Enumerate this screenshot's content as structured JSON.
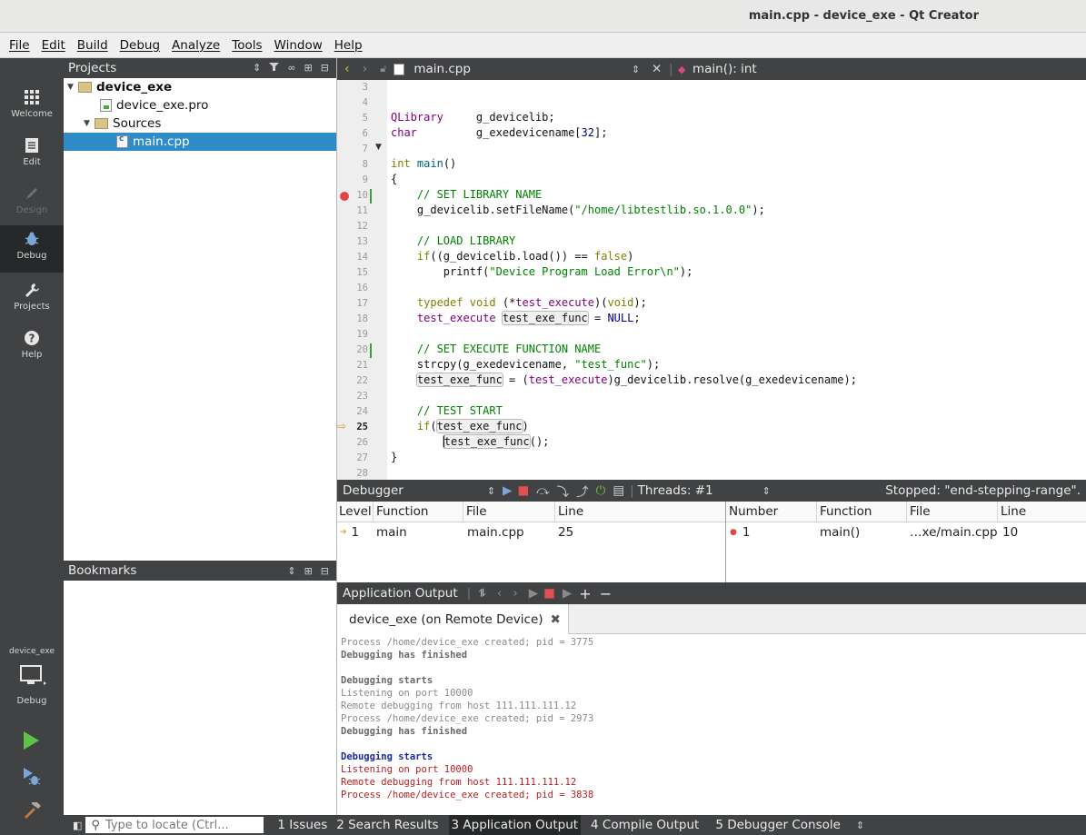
{
  "window": {
    "title": "main.cpp - device_exe - Qt Creator"
  },
  "menu": [
    "File",
    "Edit",
    "Build",
    "Debug",
    "Analyze",
    "Tools",
    "Window",
    "Help"
  ],
  "modes": [
    {
      "label": "Welcome",
      "icon": "grid-icon"
    },
    {
      "label": "Edit",
      "icon": "document-icon"
    },
    {
      "label": "Design",
      "icon": "pencil-icon"
    },
    {
      "label": "Debug",
      "icon": "bug-icon"
    },
    {
      "label": "Projects",
      "icon": "wrench-icon"
    },
    {
      "label": "Help",
      "icon": "question-icon"
    }
  ],
  "kit": {
    "project": "device_exe",
    "config": "Debug"
  },
  "projects_pane": {
    "title": "Projects",
    "tree": [
      {
        "label": "device_exe",
        "indent": 0,
        "bold": true,
        "icon": "folder-icon",
        "expanded": true
      },
      {
        "label": "device_exe.pro",
        "indent": 1,
        "icon": "pro-file-icon"
      },
      {
        "label": "Sources",
        "indent": 1,
        "icon": "folder-icon",
        "expanded": true
      },
      {
        "label": "main.cpp",
        "indent": 2,
        "icon": "cpp-file-icon",
        "selected": true
      }
    ]
  },
  "bookmarks_pane": {
    "title": "Bookmarks"
  },
  "editor": {
    "file": "main.cpp",
    "symbol": "main(): int",
    "first_line": 3,
    "current_line": 25,
    "breakpoint_line": 10
  },
  "debugger": {
    "title": "Debugger",
    "threads": "Threads: #1",
    "status": "Stopped: \"end-stepping-range\".",
    "stack_headers": [
      "Level",
      "Function",
      "File",
      "Line"
    ],
    "stack_rows": [
      {
        "level": "1",
        "function": "main",
        "file": "main.cpp",
        "line": "25"
      }
    ],
    "bp_headers": [
      "Number",
      "Function",
      "File",
      "Line"
    ],
    "bp_rows": [
      {
        "number": "1",
        "function": "main()",
        "file": "…xe/main.cpp",
        "line": "10"
      }
    ]
  },
  "app_output": {
    "title": "Application Output",
    "tab": "device_exe (on Remote Device)",
    "lines": [
      {
        "text": "Process /home/device_exe created; pid = 3775",
        "style": "grey"
      },
      {
        "text": "Debugging has finished",
        "style": "grey-b"
      },
      {
        "text": "",
        "style": "grey"
      },
      {
        "text": "Debugging starts",
        "style": "grey-b"
      },
      {
        "text": "Listening on port 10000",
        "style": "grey"
      },
      {
        "text": "Remote debugging from host 111.111.111.12",
        "style": "grey"
      },
      {
        "text": "Process /home/device_exe created; pid = 2973",
        "style": "grey"
      },
      {
        "text": "Debugging has finished",
        "style": "grey-b"
      },
      {
        "text": "",
        "style": "grey"
      },
      {
        "text": "Debugging starts",
        "style": "blue-b"
      },
      {
        "text": "Listening on port 10000",
        "style": "red"
      },
      {
        "text": "Remote debugging from host 111.111.111.12",
        "style": "red"
      },
      {
        "text": "Process /home/device_exe created; pid = 3838",
        "style": "red"
      }
    ]
  },
  "statusbar": {
    "locator_placeholder": "Type to locate (Ctrl...",
    "tabs": [
      "1 Issues",
      "2 Search Results",
      "3 Application Output",
      "4 Compile Output",
      "5 Debugger Console"
    ],
    "active_tab": 2
  }
}
